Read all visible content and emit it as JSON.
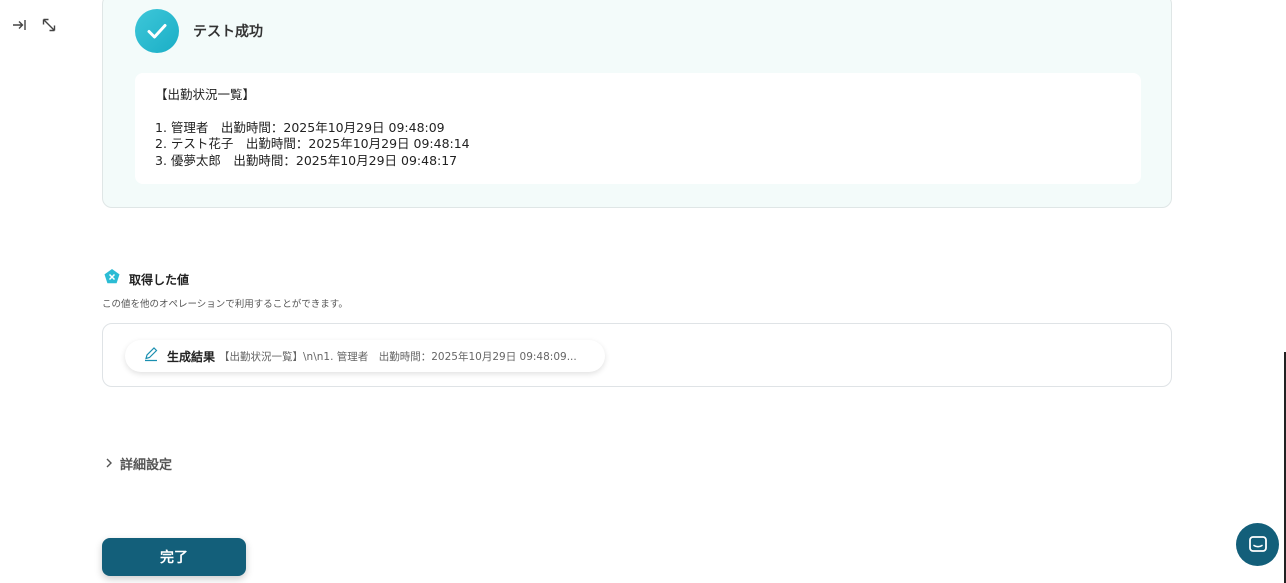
{
  "success": {
    "title": "テスト成功",
    "result_lines": [
      "【出勤状況一覧】",
      "",
      "1. 管理者　出勤時間：2025年10月29日 09:48:09",
      "2. テスト花子　出勤時間：2025年10月29日 09:48:14",
      "3. 優夢太郎　出勤時間：2025年10月29日 09:48:17"
    ]
  },
  "acquired": {
    "title": "取得した値",
    "description": "この値を他のオペレーションで利用することができます。",
    "items": [
      {
        "name": "生成結果",
        "value": "【出勤状況一覧】\\n\\n1. 管理者　出勤時間：2025年10月29日 09:48:09..."
      }
    ]
  },
  "advanced": {
    "label": "詳細設定"
  },
  "actions": {
    "done_label": "完了"
  },
  "colors": {
    "accent": "#135f7a",
    "success": "#2bbcd4",
    "panel_bg": "#f3fbfa"
  },
  "icons": [
    "collapse-right-icon",
    "expand-icon",
    "check-icon",
    "variable-icon",
    "pen-icon",
    "chevron-right-icon",
    "chat-icon"
  ]
}
